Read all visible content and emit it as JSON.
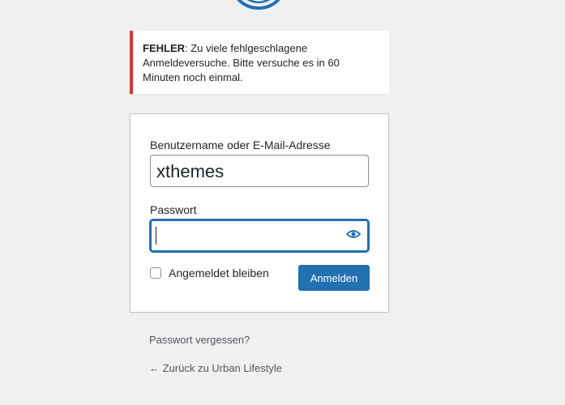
{
  "logo": {
    "icon": "wordpress-logo-icon",
    "color": "#2271b1"
  },
  "error": {
    "prefix": "FEHLER",
    "message": ": Zu viele fehlgeschlagene Anmeldeversuche. Bitte versuche es in 60 Minuten noch einmal.",
    "accent_color": "#d63638"
  },
  "form": {
    "username_label": "Benutzername oder E-Mail-Adresse",
    "username_value": "xthemes",
    "password_label": "Passwort",
    "password_value": "",
    "show_password_icon": "eye-icon",
    "remember_label": "Angemeldet bleiben",
    "remember_checked": false,
    "submit_label": "Anmelden",
    "accent_color": "#2271b1"
  },
  "links": {
    "lost_password": "Passwort vergessen?",
    "back_to_site": "← Zurück zu Urban Lifestyle"
  }
}
